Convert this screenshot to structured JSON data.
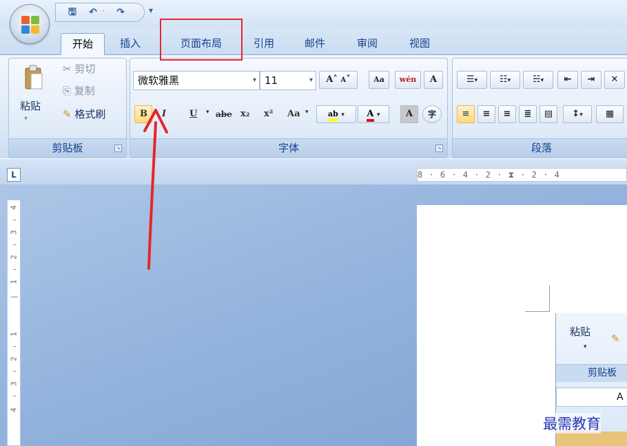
{
  "quick_access": {
    "save": "🖫",
    "undo": "↶",
    "undo_drop": "·",
    "redo": "↷",
    "more": "₹"
  },
  "tabs": [
    {
      "label": "开始",
      "active": true
    },
    {
      "label": "插入",
      "active": false
    },
    {
      "label": "页面布局",
      "active": false
    },
    {
      "label": "引用",
      "active": false
    },
    {
      "label": "邮件",
      "active": false
    },
    {
      "label": "审阅",
      "active": false
    },
    {
      "label": "视图",
      "active": false
    }
  ],
  "clipboard": {
    "cut": "剪切",
    "copy": "复制",
    "format_painter": "格式刷",
    "paste": "粘贴",
    "group_label": "剪贴板"
  },
  "font": {
    "name": "微软雅黑",
    "size": "11",
    "group_label": "字体",
    "grow": "A",
    "shrink": "A",
    "clear": "Aa",
    "phonetic": "wén",
    "border_char": "A",
    "bold": "B",
    "italic": "I",
    "underline": "U",
    "strike": "abe",
    "subscript": "x₂",
    "superscript": "x²",
    "case": "Aa",
    "highlight": "ab",
    "color": "A",
    "shade": "A",
    "enclose": "字"
  },
  "paragraph": {
    "group_label": "段落"
  },
  "ruler": {
    "corner": "L",
    "horizontal": "8 · 6 · 4 · 2 · ⧗ · 2 · 4"
  },
  "vruler_numbers": [
    "4",
    "3",
    "2",
    "1",
    "1",
    "2",
    "3",
    "4"
  ],
  "inner_image": {
    "paste": "粘贴",
    "clipboard": "剪贴板",
    "letter": "A"
  },
  "watermark": "最需教育",
  "colors": {
    "annotation_red": "#e5262a",
    "tab_text": "#15428b",
    "workspace": "#94b4dd"
  }
}
